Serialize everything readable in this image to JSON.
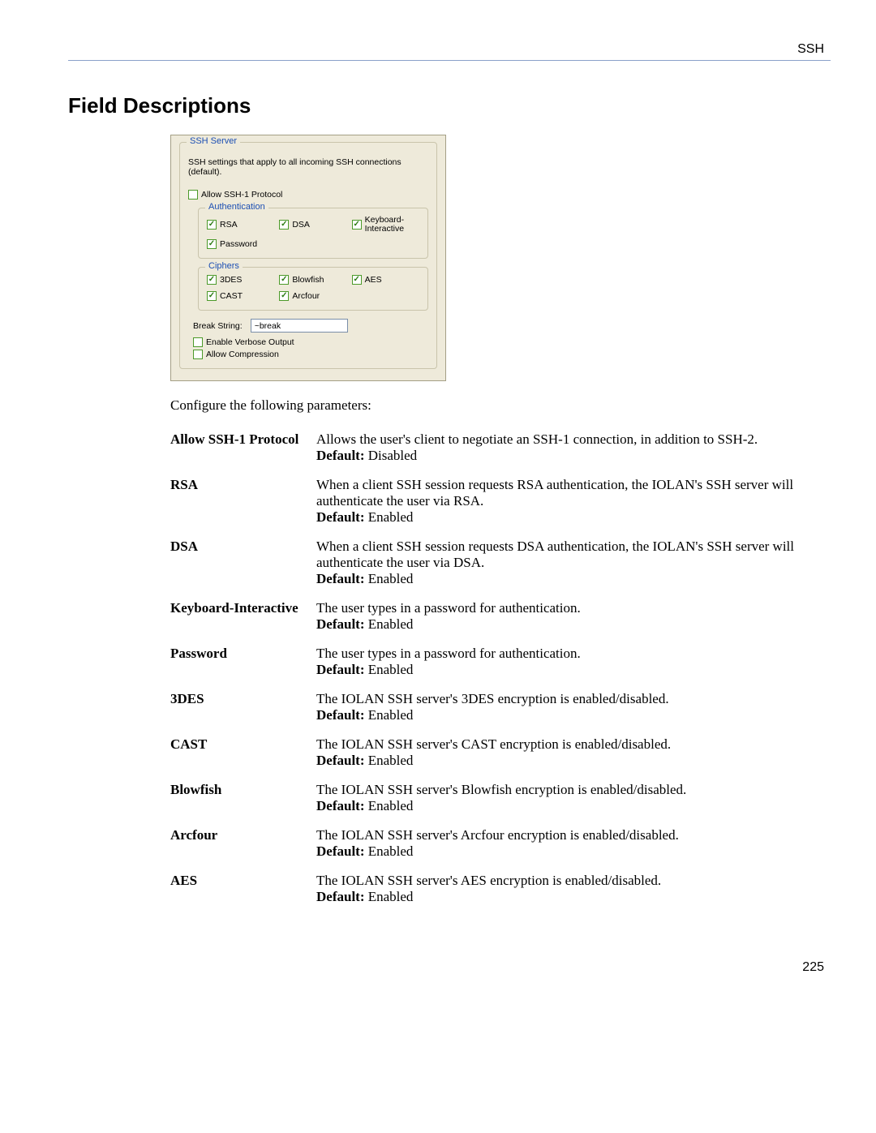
{
  "header": {
    "tag": "SSH"
  },
  "page_number": "225",
  "section_title": "Field Descriptions",
  "intro_text": "Configure the following parameters:",
  "dialog": {
    "server_legend": "SSH Server",
    "server_desc": "SSH settings that apply to all incoming SSH connections (default).",
    "allow_ssh1_label": "Allow SSH-1 Protocol",
    "auth_legend": "Authentication",
    "rsa": "RSA",
    "dsa": "DSA",
    "keyb": "Keyboard-\nInteractive",
    "password": "Password",
    "ciphers_legend": "Ciphers",
    "c3des": "3DES",
    "cblow": "Blowfish",
    "caes": "AES",
    "ccast": "CAST",
    "carc": "Arcfour",
    "break_label": "Break String:",
    "break_value": "~break",
    "verbose": "Enable Verbose Output",
    "compress": "Allow Compression"
  },
  "defaults": {
    "label": "Default:",
    "enabled": "Enabled",
    "disabled": "Disabled"
  },
  "params": [
    {
      "id": "allow_ssh1",
      "name": "Allow SSH-1 Protocol",
      "desc": "Allows the user's client to negotiate an SSH-1 connection, in addition to SSH-2.",
      "default_key": "disabled"
    },
    {
      "id": "rsa",
      "name": "RSA",
      "desc": "When a client SSH session requests RSA authentication, the IOLAN's SSH server will authenticate the user via RSA.",
      "default_key": "enabled"
    },
    {
      "id": "dsa",
      "name": "DSA",
      "desc": "When a client SSH session requests DSA authentication, the IOLAN's SSH server will authenticate the user via DSA.",
      "default_key": "enabled"
    },
    {
      "id": "keyboard_interactive",
      "name": "Keyboard-Interactive",
      "desc": "The user types in a password for authentication.",
      "default_key": "enabled"
    },
    {
      "id": "password",
      "name": "Password",
      "desc": "The user types in a password for authentication.",
      "default_key": "enabled"
    },
    {
      "id": "c3des",
      "name": "3DES",
      "desc": "The IOLAN SSH server's 3DES encryption is enabled/disabled.",
      "default_key": "enabled"
    },
    {
      "id": "cast",
      "name": "CAST",
      "desc": "The IOLAN SSH server's CAST encryption is enabled/disabled.",
      "default_key": "enabled"
    },
    {
      "id": "blowfish",
      "name": "Blowfish",
      "desc": "The IOLAN SSH server's Blowfish encryption is enabled/disabled.",
      "default_key": "enabled"
    },
    {
      "id": "arcfour",
      "name": "Arcfour",
      "desc": "The IOLAN SSH server's Arcfour encryption is enabled/disabled.",
      "default_key": "enabled"
    },
    {
      "id": "aes",
      "name": "AES",
      "desc": "The IOLAN SSH server's AES encryption is enabled/disabled.",
      "default_key": "enabled"
    }
  ]
}
